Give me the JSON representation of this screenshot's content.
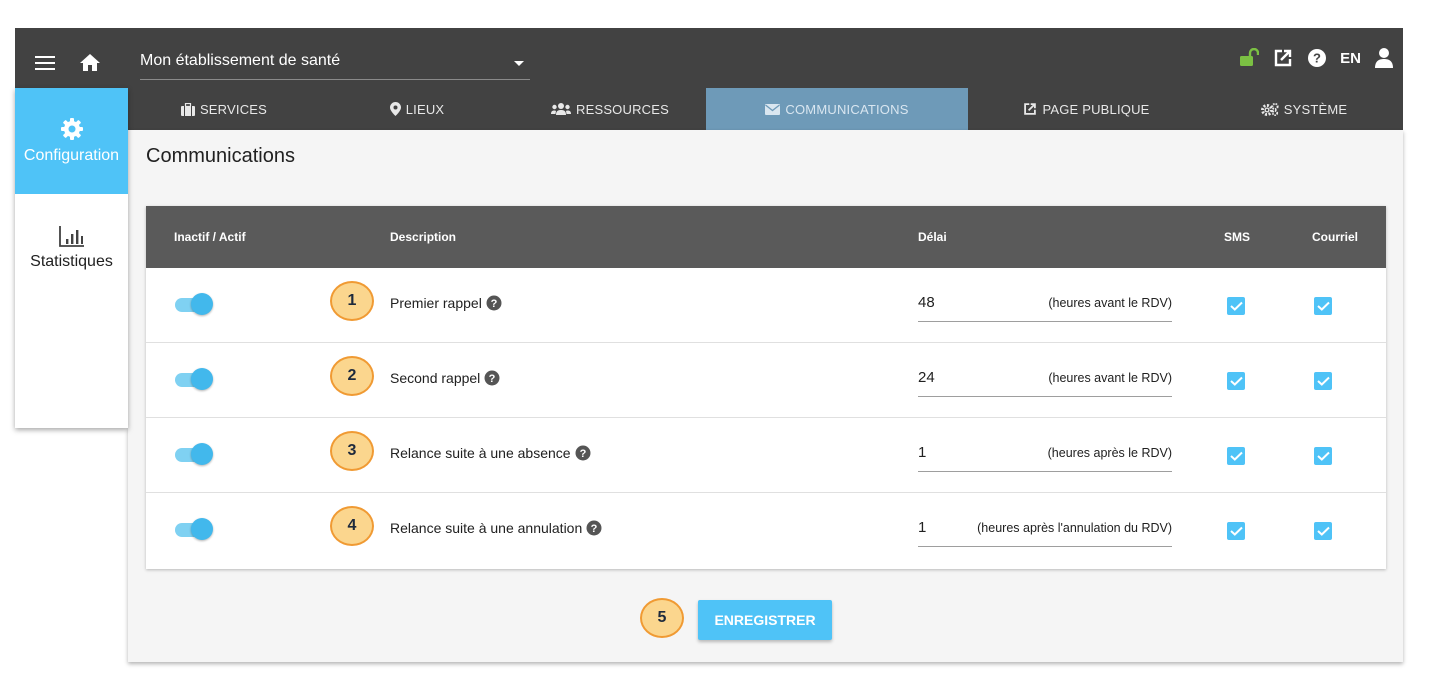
{
  "header": {
    "establishment": "Mon établissement de santé",
    "lang": "EN",
    "icons": [
      "menu-icon",
      "home-icon",
      "unlock-icon",
      "external-link-icon",
      "help-icon",
      "user-icon"
    ],
    "accent_color": "#4fc3f7",
    "unlock_color": "#7bc043"
  },
  "sidenav": {
    "items": [
      {
        "label": "Configuration",
        "icon": "gear-icon",
        "active": true
      },
      {
        "label": "Statistiques",
        "icon": "bar-chart-icon",
        "active": false
      }
    ]
  },
  "tabs": [
    {
      "label": "SERVICES",
      "icon": "briefcase-icon"
    },
    {
      "label": "LIEUX",
      "icon": "map-marker-icon"
    },
    {
      "label": "RESSOURCES",
      "icon": "users-icon"
    },
    {
      "label": "COMMUNICATIONS",
      "icon": "envelope-icon",
      "active": true
    },
    {
      "label": "PAGE PUBLIQUE",
      "icon": "external-link-icon"
    },
    {
      "label": "SYSTÈME",
      "icon": "gears-icon"
    }
  ],
  "page": {
    "title": "Communications"
  },
  "table": {
    "headers": {
      "active": "Inactif / Actif",
      "description": "Description",
      "delay": "Délai",
      "sms": "SMS",
      "email": "Courriel"
    },
    "rows": [
      {
        "num": "1",
        "description": "Premier rappel",
        "delay": "48",
        "unit": "(heures avant le RDV)",
        "active": true,
        "sms": true,
        "email": true
      },
      {
        "num": "2",
        "description": "Second rappel",
        "delay": "24",
        "unit": "(heures avant le RDV)",
        "active": true,
        "sms": true,
        "email": true
      },
      {
        "num": "3",
        "description": "Relance suite à une absence",
        "delay": "1",
        "unit": "(heures après le RDV)",
        "active": true,
        "sms": true,
        "email": true
      },
      {
        "num": "4",
        "description": "Relance suite à une annulation",
        "delay": "1",
        "unit": "(heures après l'annulation du RDV)",
        "active": true,
        "sms": true,
        "email": true
      }
    ]
  },
  "save": {
    "num": "5",
    "label": "ENREGISTRER"
  }
}
